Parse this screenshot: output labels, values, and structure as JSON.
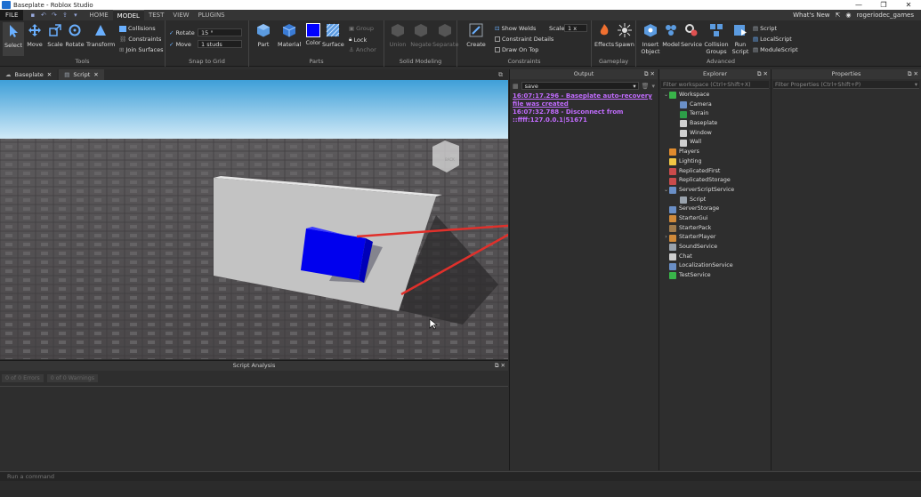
{
  "window": {
    "title": "Baseplate - Roblox Studio",
    "minimize": "—",
    "maximize": "❐",
    "close": "✕"
  },
  "menu": {
    "file": "FILE",
    "tabs": [
      "HOME",
      "MODEL",
      "TEST",
      "VIEW",
      "PLUGINS"
    ],
    "active_tab": "MODEL",
    "whats_new": "What's New",
    "username": "rogeriodec_games"
  },
  "ribbon": {
    "tools": {
      "label": "Tools",
      "select": "Select",
      "move": "Move",
      "scale": "Scale",
      "rotate": "Rotate",
      "transform": "Transform",
      "collisions": "Collisions",
      "constraints": "Constraints",
      "join_surfaces": "Join Surfaces"
    },
    "snap": {
      "label": "Snap to Grid",
      "rotate_label": "Rotate",
      "rotate_value": "15 °",
      "move_label": "Move",
      "move_value": "1 studs"
    },
    "parts": {
      "label": "Parts",
      "part": "Part",
      "material": "Material",
      "color": "Color",
      "surface": "Surface",
      "group": "Group",
      "lock": "Lock",
      "anchor": "Anchor",
      "color_value": "#0000ff"
    },
    "solid": {
      "label": "Solid Modeling",
      "union": "Union",
      "negate": "Negate",
      "separate": "Separate"
    },
    "constraints": {
      "label": "Constraints",
      "create": "Create",
      "show_welds": "Show Welds",
      "constraint_details": "Constraint Details",
      "draw_on_top": "Draw On Top",
      "scale_label": "Scale",
      "scale_value": "1 x"
    },
    "gameplay": {
      "label": "Gameplay",
      "effects": "Effects",
      "spawn": "Spawn"
    },
    "advanced": {
      "label": "Advanced",
      "insert_object": [
        "Insert",
        "Object"
      ],
      "model": "Model",
      "service": "Service",
      "collision_groups": [
        "Collision",
        "Groups"
      ],
      "run_script": [
        "Run",
        "Script"
      ],
      "script": "Script",
      "local_script": "LocalScript",
      "module_script": "ModuleScript"
    }
  },
  "doc_tabs": [
    {
      "label": "Baseplate",
      "active": true
    },
    {
      "label": "Script",
      "active": false
    }
  ],
  "viewport": {
    "cube_label": "BACK"
  },
  "script_analysis": {
    "title": "Script Analysis",
    "errors": "0 of 0 Errors",
    "warnings": "0 of 0 Warnings"
  },
  "output": {
    "title": "Output",
    "filter_value": "save",
    "lines": [
      {
        "text": "16:07:17.296 - Baseplate auto-recovery file was created",
        "link": true
      },
      {
        "text": "16:07:32.788 - Disconnect from ::ffff:127.0.0.1|51671",
        "link": false
      }
    ]
  },
  "explorer": {
    "title": "Explorer",
    "filter_placeholder": "Filter workspace (Ctrl+Shift+X)",
    "items": [
      {
        "label": "Workspace",
        "depth": 0,
        "expand": "⌄",
        "color": "#39b54a"
      },
      {
        "label": "Camera",
        "depth": 1,
        "expand": "",
        "color": "#6a8fc7"
      },
      {
        "label": "Terrain",
        "depth": 1,
        "expand": "",
        "color": "#2d9e48"
      },
      {
        "label": "Baseplate",
        "depth": 1,
        "expand": "",
        "color": "#cfcfcf"
      },
      {
        "label": "Window",
        "depth": 1,
        "expand": "",
        "color": "#cfcfcf"
      },
      {
        "label": "Wall",
        "depth": 1,
        "expand": "",
        "color": "#cfcfcf"
      },
      {
        "label": "Players",
        "depth": 0,
        "expand": "",
        "color": "#e08b2d"
      },
      {
        "label": "Lighting",
        "depth": 0,
        "expand": "",
        "color": "#f2c744"
      },
      {
        "label": "ReplicatedFirst",
        "depth": 0,
        "expand": "",
        "color": "#c94b4b"
      },
      {
        "label": "ReplicatedStorage",
        "depth": 0,
        "expand": "",
        "color": "#c94b4b"
      },
      {
        "label": "ServerScriptService",
        "depth": 0,
        "expand": "⌄",
        "color": "#6a8fc7"
      },
      {
        "label": "Script",
        "depth": 1,
        "expand": "",
        "color": "#9aa3ad"
      },
      {
        "label": "ServerStorage",
        "depth": 0,
        "expand": "",
        "color": "#6a8fc7"
      },
      {
        "label": "StarterGui",
        "depth": 0,
        "expand": "",
        "color": "#d08a3a"
      },
      {
        "label": "StarterPack",
        "depth": 0,
        "expand": "",
        "color": "#a07b4c"
      },
      {
        "label": "StarterPlayer",
        "depth": 0,
        "expand": "›",
        "color": "#d08a3a"
      },
      {
        "label": "SoundService",
        "depth": 0,
        "expand": "",
        "color": "#9aa3ad"
      },
      {
        "label": "Chat",
        "depth": 0,
        "expand": "",
        "color": "#cfcfcf"
      },
      {
        "label": "LocalizationService",
        "depth": 0,
        "expand": "",
        "color": "#6a8fc7"
      },
      {
        "label": "TestService",
        "depth": 0,
        "expand": "",
        "color": "#39b54a"
      }
    ]
  },
  "properties": {
    "title": "Properties",
    "filter_placeholder": "Filter Properties (Ctrl+Shift+P)"
  },
  "command_bar": {
    "placeholder": "Run a command"
  }
}
